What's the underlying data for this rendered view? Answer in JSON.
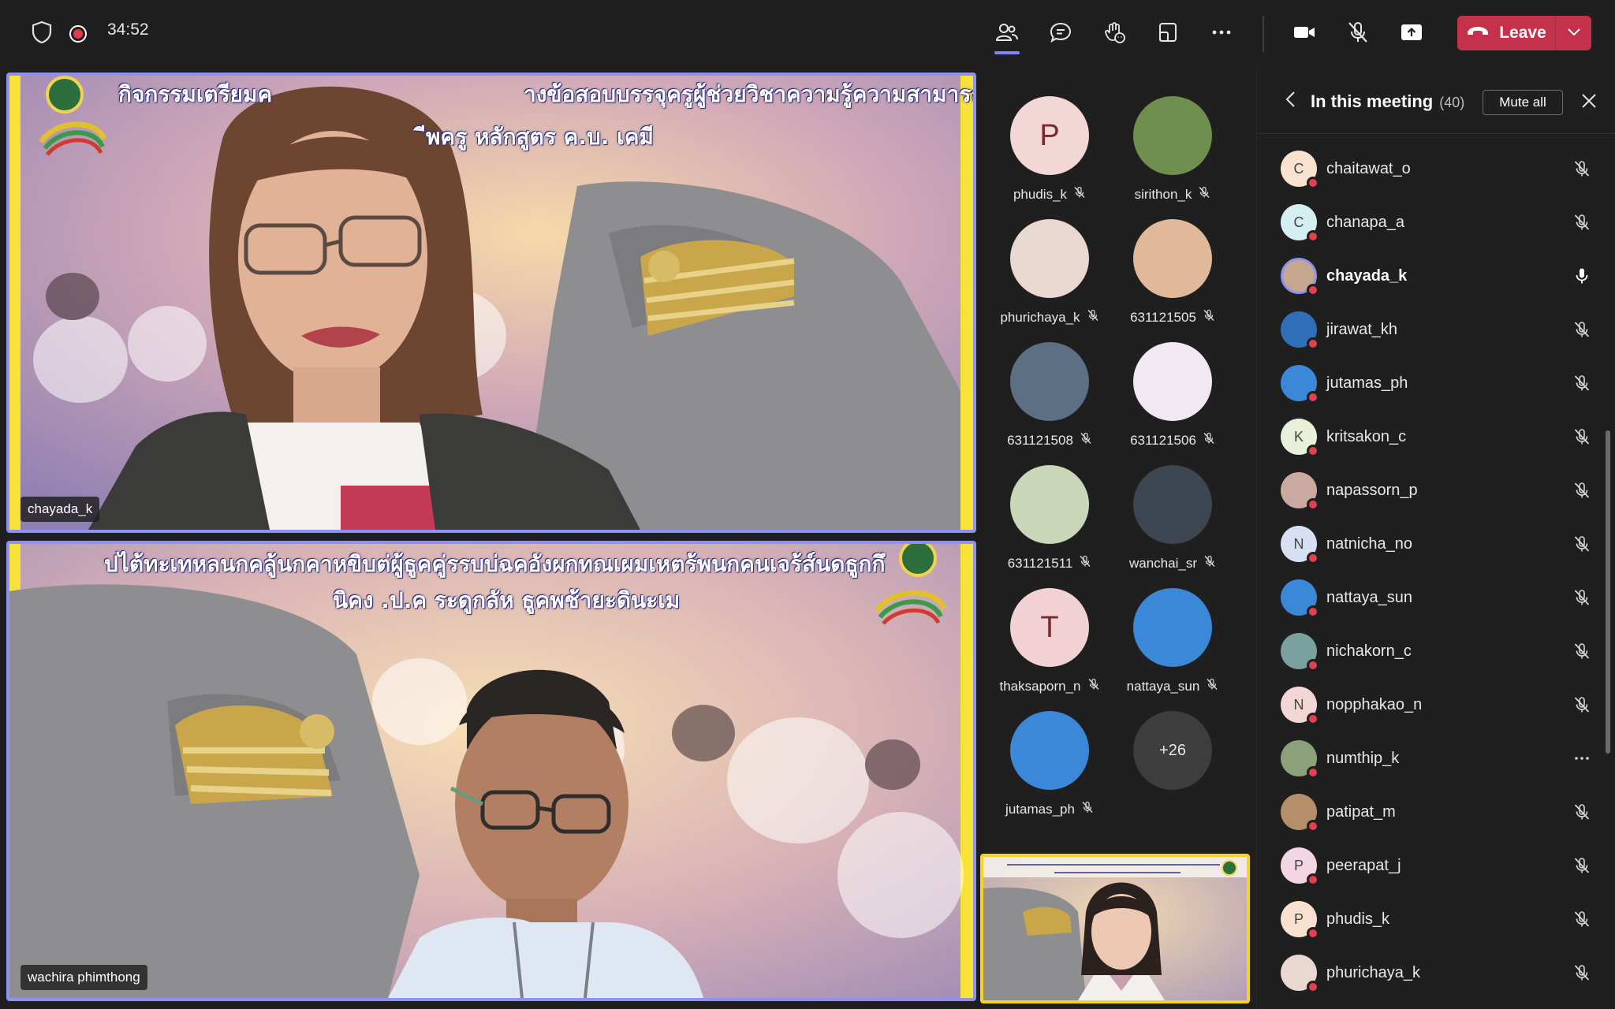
{
  "topbar": {
    "timer": "34:52",
    "leave_label": "Leave",
    "icons": [
      "shield-icon",
      "recording-icon",
      "people-icon",
      "chat-icon",
      "reactions-icon",
      "view-icon",
      "more-icon",
      "camera-icon",
      "mic-off-icon",
      "share-icon",
      "phone-icon",
      "chevron-down-icon"
    ]
  },
  "videos": {
    "main_1": {
      "name": "chayada_k",
      "slide_line1": "กิจกรรมเตรียมค",
      "slide_line1b": "างข้อสอบบรรจุครูผู้ช่วยวิชาความรู้ความสามารถทั่วไป",
      "slide_line2": "ีพครู หลักสูตร ค.บ. เคมี"
    },
    "main_2": {
      "name": "wachira phimthong",
      "slide_line1": "ปไต้ทะเทหลนกคลู้นกคาหขิบต่ผู้ธูคคู่รรบบ่ฉคอังผกทณเผมเหตร้พนกคนเจร้ส์นดธูกกึ",
      "slide_line2": "นิคง .ป.ค ระดูกลัห ธูคพช้ายะดินะเม"
    }
  },
  "grid": {
    "participants": [
      {
        "name": "phudis_k",
        "initial": "P",
        "avatar_bg": "#f3d6d6",
        "initial_color": "#7a2a2a"
      },
      {
        "name": "sirithon_k",
        "initial": "",
        "avatar_bg": "#6f8f4f"
      },
      {
        "name": "phurichaya_k",
        "initial": "",
        "avatar_bg": "#e8d8d0"
      },
      {
        "name": "631121505",
        "initial": "",
        "avatar_bg": "#e0b99a"
      },
      {
        "name": "631121508",
        "initial": "",
        "avatar_bg": "#5d6f82"
      },
      {
        "name": "631121506",
        "initial": "",
        "avatar_bg": "#f1e8f3"
      },
      {
        "name": "631121511",
        "initial": "",
        "avatar_bg": "#c9d6b8"
      },
      {
        "name": "wanchai_sr",
        "initial": "",
        "avatar_bg": "#3c4550"
      },
      {
        "name": "thaksaporn_n",
        "initial": "T",
        "avatar_bg": "#f1d1d4",
        "initial_color": "#7a2a2a"
      },
      {
        "name": "nattaya_sun",
        "initial": "",
        "avatar_bg": "#3b88d8"
      },
      {
        "name": "jutamas_ph",
        "initial": "",
        "avatar_bg": "#3b88d8"
      }
    ],
    "overflow_label": "+26"
  },
  "panel": {
    "title": "In this meeting",
    "count": "(40)",
    "mute_all_label": "Mute all",
    "people": [
      {
        "name": "chaitawat_o",
        "initial": "C",
        "avatar_bg": "#f7e3cf",
        "mic": "off"
      },
      {
        "name": "chanapa_a",
        "initial": "C",
        "avatar_bg": "#d4eef2",
        "mic": "off"
      },
      {
        "name": "chayada_k",
        "initial": "",
        "avatar_bg": "#c7a68f",
        "mic": "on",
        "bold": true,
        "ring": true
      },
      {
        "name": "jirawat_kh",
        "initial": "",
        "avatar_bg": "#2f6fb8",
        "mic": "off"
      },
      {
        "name": "jutamas_ph",
        "initial": "",
        "avatar_bg": "#3b88d8",
        "mic": "off"
      },
      {
        "name": "kritsakon_c",
        "initial": "K",
        "avatar_bg": "#e7f0d9",
        "mic": "off"
      },
      {
        "name": "napassorn_p",
        "initial": "",
        "avatar_bg": "#caa9a0",
        "mic": "off"
      },
      {
        "name": "natnicha_no",
        "initial": "N",
        "avatar_bg": "#d7e0f2",
        "mic": "off"
      },
      {
        "name": "nattaya_sun",
        "initial": "",
        "avatar_bg": "#3b88d8",
        "mic": "off"
      },
      {
        "name": "nichakorn_c",
        "initial": "",
        "avatar_bg": "#7aa0a0",
        "mic": "off"
      },
      {
        "name": "nopphakao_n",
        "initial": "N",
        "avatar_bg": "#f3d6d6",
        "mic": "off"
      },
      {
        "name": "numthip_k",
        "initial": "",
        "avatar_bg": "#8ca07a",
        "mic": "more"
      },
      {
        "name": "patipat_m",
        "initial": "",
        "avatar_bg": "#b58f6a",
        "mic": "off"
      },
      {
        "name": "peerapat_j",
        "initial": "P",
        "avatar_bg": "#f3d6e3",
        "mic": "off"
      },
      {
        "name": "phudis_k",
        "initial": "P",
        "avatar_bg": "#f7e0d0",
        "mic": "off"
      },
      {
        "name": "phurichaya_k",
        "initial": "",
        "avatar_bg": "#e8d8d0",
        "mic": "off"
      }
    ]
  },
  "colors": {
    "accent": "#7f85f5",
    "leave": "#c4314b",
    "self_border": "#f7d420",
    "status_dot": "#e04050"
  }
}
